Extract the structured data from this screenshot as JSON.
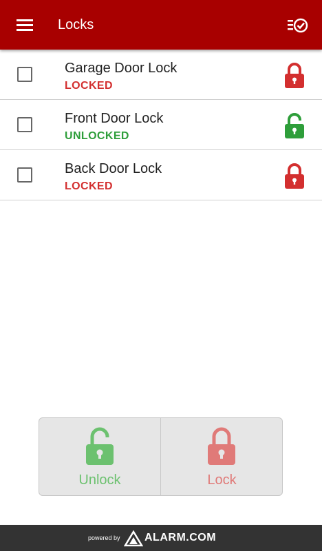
{
  "colors": {
    "app_bar": "#a80000",
    "locked": "#d32f2f",
    "unlocked": "#2e9e3a",
    "unlock_action": "#6cc16f",
    "lock_action": "#e07a78",
    "footer": "#333333"
  },
  "header": {
    "title": "Locks",
    "menu_icon": "hamburger-menu-icon",
    "action_icon": "manage-list-check-icon"
  },
  "locks": [
    {
      "name": "Garage Door Lock",
      "status": "LOCKED",
      "state": "locked",
      "checked": false
    },
    {
      "name": "Front Door Lock",
      "status": "UNLOCKED",
      "state": "unlocked",
      "checked": false
    },
    {
      "name": "Back Door Lock",
      "status": "LOCKED",
      "state": "locked",
      "checked": false
    }
  ],
  "actions": {
    "unlock_label": "Unlock",
    "lock_label": "Lock"
  },
  "footer": {
    "powered_by": "powered by",
    "brand": "ALARM.COM"
  }
}
